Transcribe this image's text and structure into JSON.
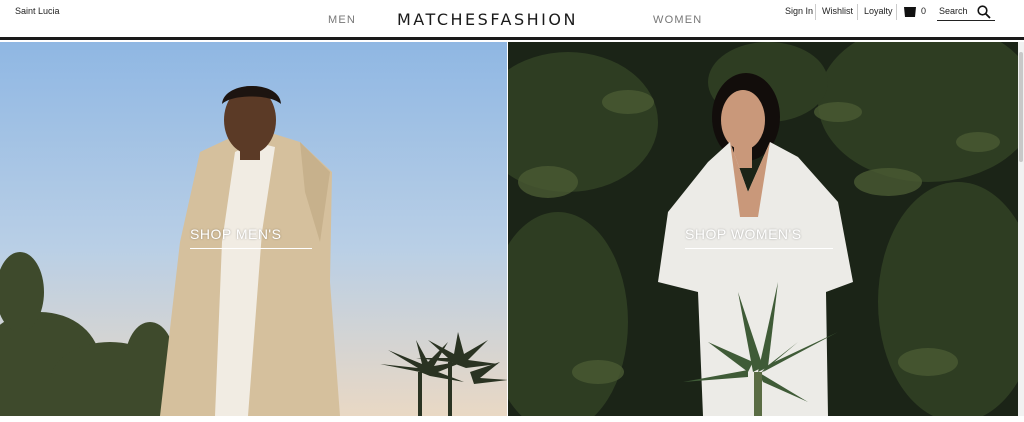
{
  "header": {
    "region": "Saint Lucia",
    "logo": "MATCHESFASHION",
    "nav_men": "MEN",
    "nav_women": "WOMEN",
    "sign_in": "Sign In",
    "wishlist": "Wishlist",
    "loyalty": "Loyalty",
    "bag_count": "0",
    "search_label": "Search",
    "icons": {
      "bag": "shopping-bag-icon",
      "search": "search-icon"
    }
  },
  "hero": {
    "men": {
      "cta": "SHOP MEN'S"
    },
    "women": {
      "cta": "SHOP WOMEN'S"
    }
  },
  "colors": {
    "header_rule": "#1a1a1a",
    "cta_text": "#ffffff"
  }
}
